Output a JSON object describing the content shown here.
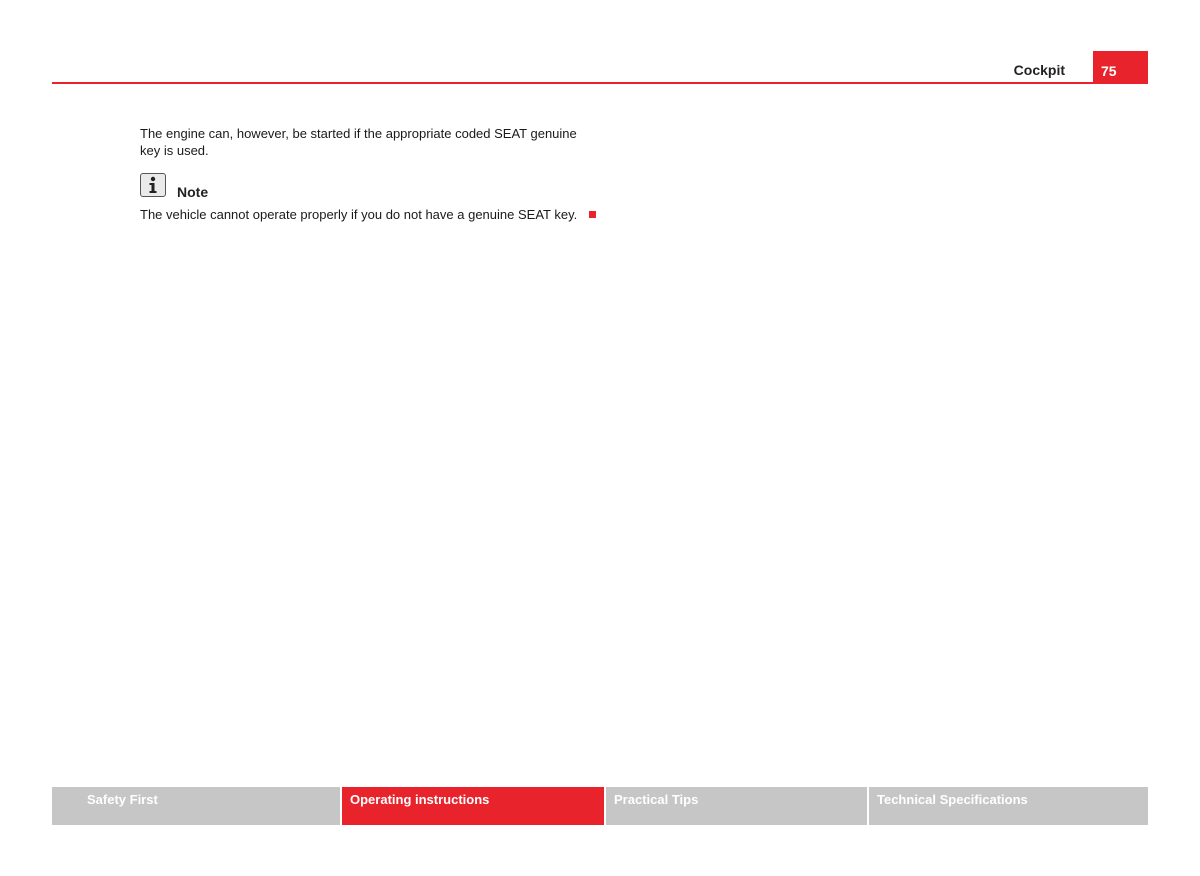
{
  "header": {
    "section_title": "Cockpit",
    "page_number": "75",
    "accent_color": "#e8232b"
  },
  "content": {
    "paragraph": "The engine can, however, be started if the appropriate coded SEAT genuine key is used.",
    "note": {
      "icon": "info-icon",
      "heading": "Note",
      "text": "The vehicle cannot operate properly if you do not have a genuine SEAT key."
    }
  },
  "footer": {
    "tabs": [
      {
        "label": "Safety First",
        "active": false
      },
      {
        "label": "Operating instructions",
        "active": true
      },
      {
        "label": "Practical Tips",
        "active": false
      },
      {
        "label": "Technical Specifications",
        "active": false
      }
    ]
  }
}
